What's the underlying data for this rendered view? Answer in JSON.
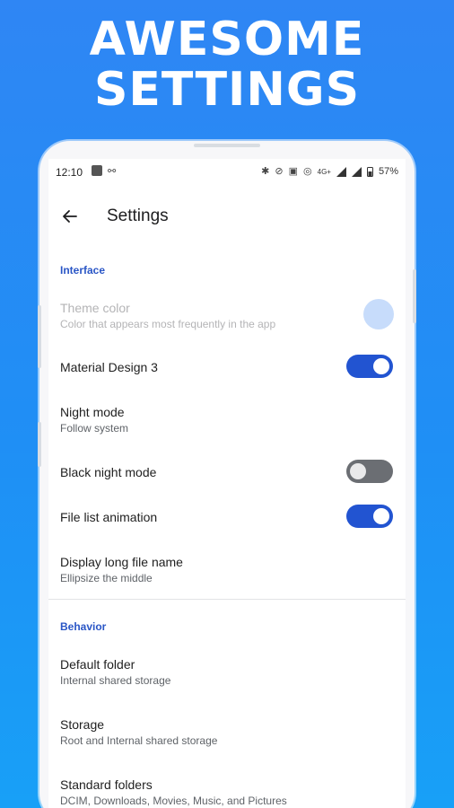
{
  "headline": {
    "line1": "AWESOME",
    "line2": "SETTINGS"
  },
  "status_bar": {
    "time": "12:10",
    "network": "4G+",
    "battery": "57%"
  },
  "app_bar": {
    "title": "Settings"
  },
  "sections": {
    "interface": "Interface",
    "behavior": "Behavior"
  },
  "prefs": {
    "theme_color": {
      "title": "Theme color",
      "summary": "Color that appears most frequently in the app",
      "enabled": false,
      "color": "#c7dcfb"
    },
    "material3": {
      "title": "Material Design 3",
      "on": true
    },
    "night_mode": {
      "title": "Night mode",
      "summary": "Follow system"
    },
    "black_night": {
      "title": "Black night mode",
      "on": false
    },
    "file_anim": {
      "title": "File list animation",
      "on": true
    },
    "long_name": {
      "title": "Display long file name",
      "summary": "Ellipsize the middle"
    },
    "default_folder": {
      "title": "Default folder",
      "summary": "Internal shared storage"
    },
    "storage": {
      "title": "Storage",
      "summary": "Root and Internal shared storage"
    },
    "standard_folders": {
      "title": "Standard folders",
      "summary": "DCIM, Downloads, Movies, Music, and Pictures"
    }
  },
  "colors": {
    "accent": "#2254d1",
    "section": "#2a56c6",
    "background_top": "#2f86f4"
  }
}
